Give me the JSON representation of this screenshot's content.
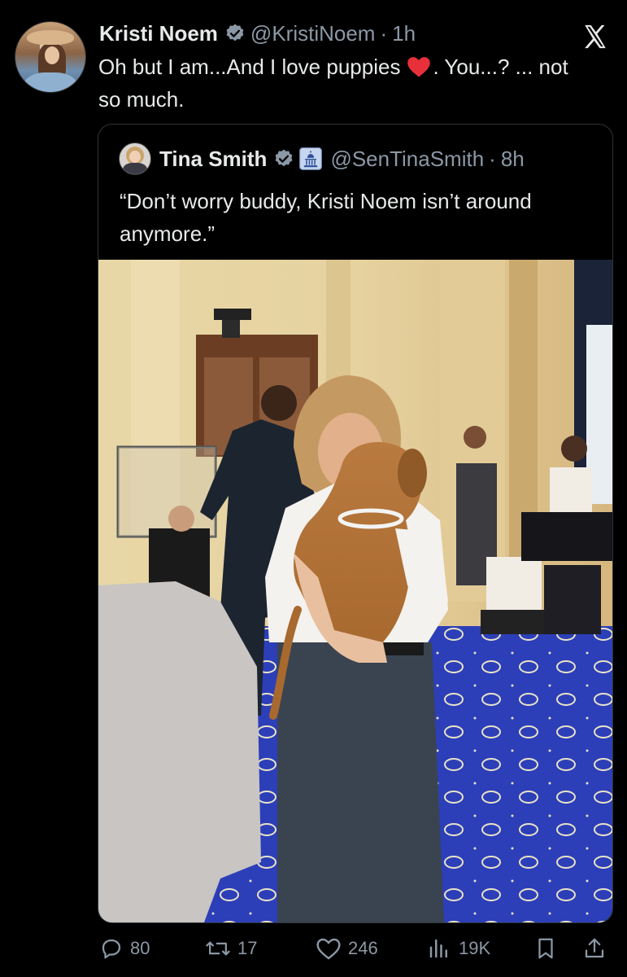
{
  "tweet": {
    "author_name": "Kristi Noem",
    "handle": "@KristiNoem",
    "separator": "·",
    "time": "1h",
    "text_part1": "Oh but I am...And I love puppies",
    "text_part2": ". You...? ... not so much.",
    "emoji": "red-heart"
  },
  "quote": {
    "author_name": "Tina Smith",
    "handle": "@SenTinaSmith",
    "separator": "·",
    "time": "8h",
    "text": "“Don’t worry buddy, Kristi Noem isn’t around anymore.”"
  },
  "actions": {
    "replies": "80",
    "reposts": "17",
    "likes": "246",
    "views": "19K"
  },
  "colors": {
    "background": "#000000",
    "text": "#e7e9ea",
    "secondary": "#8b98a5",
    "verified": "#1d9bf0",
    "border": "#2f3336",
    "carpet": "#2c3fb8"
  }
}
